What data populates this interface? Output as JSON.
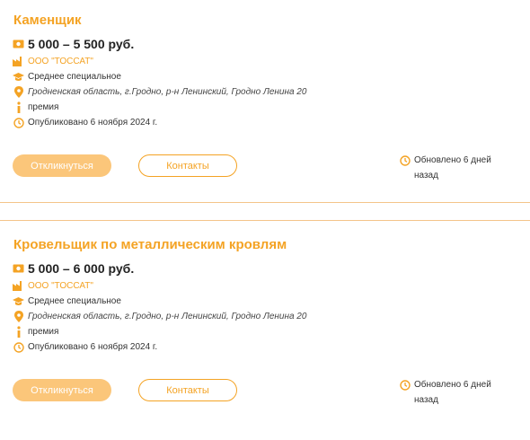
{
  "colors": {
    "accent": "#f4a324",
    "button_fill": "#fbc67a",
    "divider": "#f4c48a"
  },
  "vacancies": [
    {
      "title": "Каменщик",
      "salary": "5 000 – 5 500 руб.",
      "company": "ООО \"ТОССАТ\"",
      "education": "Среднее специальное",
      "address": "Гродненская область, г.Гродно, р-н Ленинский, Гродно Ленина 20",
      "bonus": "премия",
      "published": "Опубликовано 6 ноября 2024 г.",
      "apply_label": "Откликнуться",
      "contacts_label": "Контакты",
      "updated": "Обновлено 6 дней назад"
    },
    {
      "title": "Кровельщик по металлическим кровлям",
      "salary": "5 000 – 6 000 руб.",
      "company": "ООО \"ТОССАТ\"",
      "education": "Среднее специальное",
      "address": "Гродненская область, г.Гродно, р-н Ленинский, Гродно Ленина 20",
      "bonus": "премия",
      "published": "Опубликовано 6 ноября 2024 г.",
      "apply_label": "Откликнуться",
      "contacts_label": "Контакты",
      "updated": "Обновлено 6 дней назад"
    }
  ],
  "icons": [
    "money-icon",
    "factory-icon",
    "graduation-cap-icon",
    "location-pin-icon",
    "info-icon",
    "clock-icon"
  ]
}
